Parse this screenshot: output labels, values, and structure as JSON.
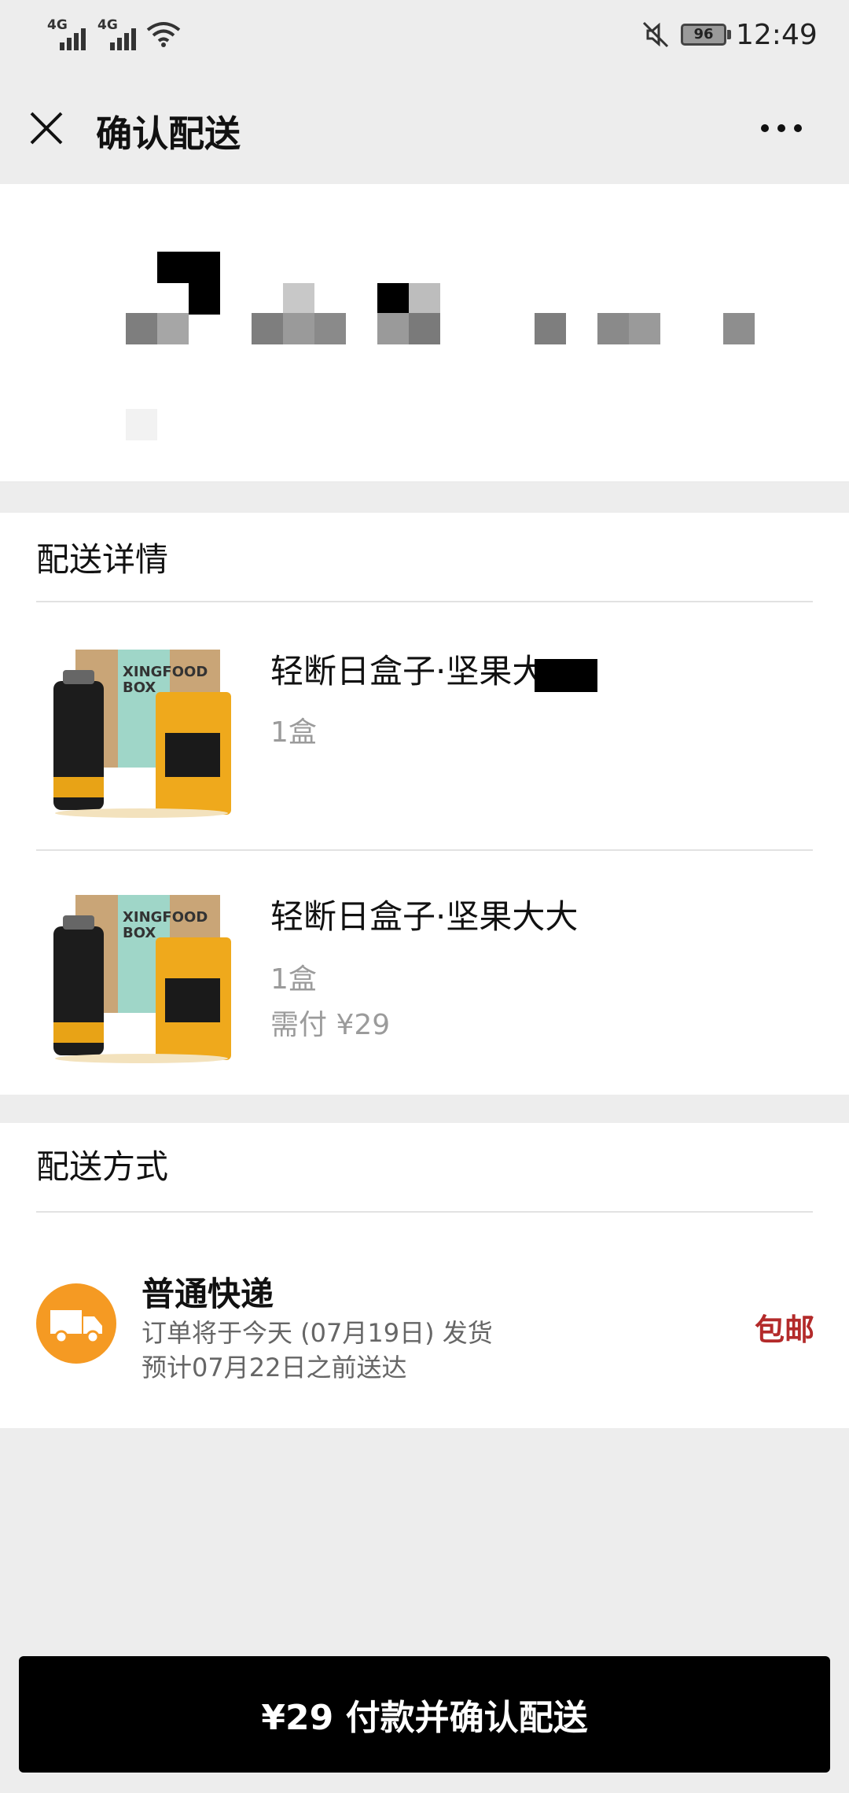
{
  "status_bar": {
    "signal_1_label": "4G",
    "signal_2_label": "4G",
    "battery_level": "96",
    "time": "12:49"
  },
  "nav": {
    "title": "确认配送"
  },
  "delivery_details": {
    "section_title": "配送详情",
    "products": [
      {
        "name": "轻断日盒子·坚果大",
        "quantity": "1盒",
        "price_label": ""
      },
      {
        "name": "轻断日盒子·坚果大大",
        "quantity": "1盒",
        "price_label": "需付 ¥29"
      }
    ]
  },
  "shipping": {
    "section_title": "配送方式",
    "method_name": "普通快递",
    "ship_date_line": "订单将于今天 (07月19日) 发货",
    "eta_line": "预计07月22日之前送达",
    "fee_label": "包邮"
  },
  "pay_button": {
    "label": "¥29 付款并确认配送"
  },
  "colors": {
    "background": "#ededed",
    "accent_orange": "#f59a23",
    "free_shipping_red": "#b32a2a",
    "button_black": "#000000"
  }
}
